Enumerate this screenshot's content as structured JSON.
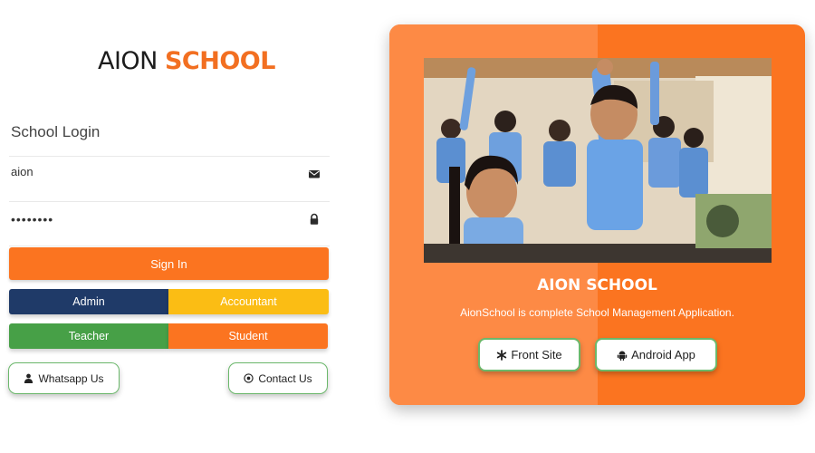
{
  "brand": {
    "name_part1": "AION ",
    "name_part2": "SCHOOL"
  },
  "login": {
    "title": "School Login",
    "username_value": "aion",
    "password_value": "••••••••",
    "signin_label": "Sign In"
  },
  "roles": {
    "admin": "Admin",
    "accountant": "Accountant",
    "teacher": "Teacher",
    "student": "Student"
  },
  "links": {
    "whatsapp": "Whatsapp Us",
    "contact": "Contact Us"
  },
  "card": {
    "title": "AION SCHOOL",
    "subtitle": "AionSchool is complete School Management Application.",
    "front_site": "Front Site",
    "android_app": "Android App"
  },
  "icons": {
    "username": "envelope-icon",
    "password": "lock-icon",
    "whatsapp": "user-icon",
    "contact": "circle-icon",
    "front_site": "asterisk-icon",
    "android_app": "android-icon"
  },
  "colors": {
    "brand_orange": "#fb7420",
    "admin_navy": "#1f3a68",
    "accountant_yellow": "#fbbd14",
    "teacher_green": "#47a047",
    "pill_border_green": "#6bb86b"
  }
}
